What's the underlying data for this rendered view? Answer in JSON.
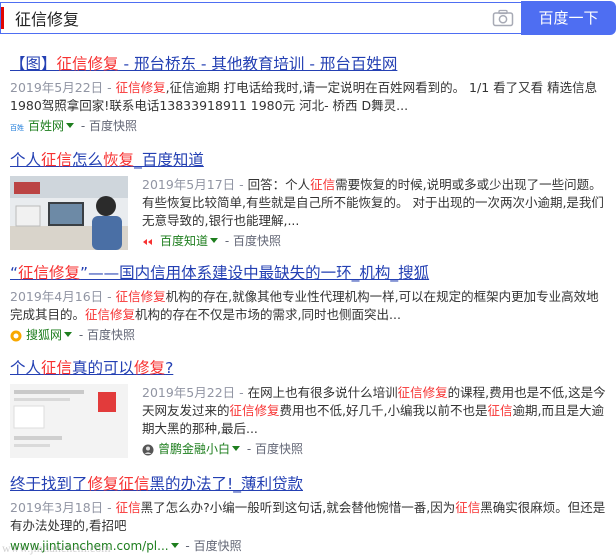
{
  "search": {
    "query": "征信修复",
    "button_label": "百度一下"
  },
  "results": [
    {
      "title_parts": [
        "【图】",
        "征信修复",
        " - 邢台桥东 - 其他教育培训 - 邢台百姓网"
      ],
      "date": "2019年5月22日 - ",
      "abstract_parts": [
        "",
        "征信修复",
        ",征信逾期 打电话给我时,请一定说明在百姓网看到的。 1/1 看了又看 精选信息 1980驾照拿回家!联系电话13833918911 1980元 河北- 桥西 D舞灵..."
      ],
      "source": "百姓网",
      "separator": " - ",
      "snapshot": "百度快照",
      "source_icon": "baixing-icon"
    },
    {
      "title_parts": [
        "个人",
        "征信",
        "怎么",
        "恢复",
        "_百度知道"
      ],
      "date": "2019年5月17日 - ",
      "abstract_parts": [
        "回答：个人",
        "征信",
        "需要恢复的时候,说明或多或少出现了一些问题。有些恢复比较简单,有些就是自己所不能恢复的。 对于出现的一次两次小逾期,是我们无意导致的,银行也能理解,..."
      ],
      "source": "百度知道",
      "separator": " - ",
      "snapshot": "百度快照",
      "source_icon": "zhidao-icon"
    },
    {
      "title_parts": [
        "“",
        "征信修复",
        "”——国内信用体系建设中最缺失的一环_机构_搜狐"
      ],
      "date": "2019年4月16日 - ",
      "abstract_parts": [
        "",
        "征信修复",
        "机构的存在,就像其他专业性代理机构一样,可以在规定的框架内更加专业高效地完成其目的。",
        "征信修复",
        "机构的存在不仅是市场的需求,同时也侧面突出..."
      ],
      "source": "搜狐网",
      "separator": " - ",
      "snapshot": "百度快照",
      "source_icon": "sohu-icon"
    },
    {
      "title_parts": [
        "个人",
        "征信",
        "真的可以",
        "修复",
        "?"
      ],
      "date": "2019年5月22日 - ",
      "abstract_parts": [
        "在网上也有很多说什么培训",
        "征信修复",
        "的课程,费用也是不低,这是今天网友发过来的",
        "征信修复",
        "费用也不低,好几千,小编我以前不也是",
        "征信",
        "逾期,而且是大逾期大黑的那种,最后..."
      ],
      "source": "曾鹏金融小白",
      "separator": " - ",
      "snapshot": "百度快照",
      "source_icon": "user-avatar-icon"
    },
    {
      "title_parts": [
        "终于找到了",
        "修复征信",
        "黑的办法了!_薄利贷款"
      ],
      "date": "2019年3月18日 - ",
      "abstract_parts": [
        "",
        "征信",
        "黑了怎么办?小编一般听到这句话,就会替他惋惜一番,因为",
        "征信",
        "黑确实很麻烦。但还是有办法处理的,看招吧"
      ],
      "source": "www.jintianchem.com/pl...",
      "separator": " - ",
      "snapshot": "百度快照",
      "source_icon": ""
    }
  ],
  "thumbs": {
    "r2": "person-at-bank-counter-photo",
    "r4": "phone-screenshot-photo"
  },
  "watermark": "www.jintianchem.com"
}
